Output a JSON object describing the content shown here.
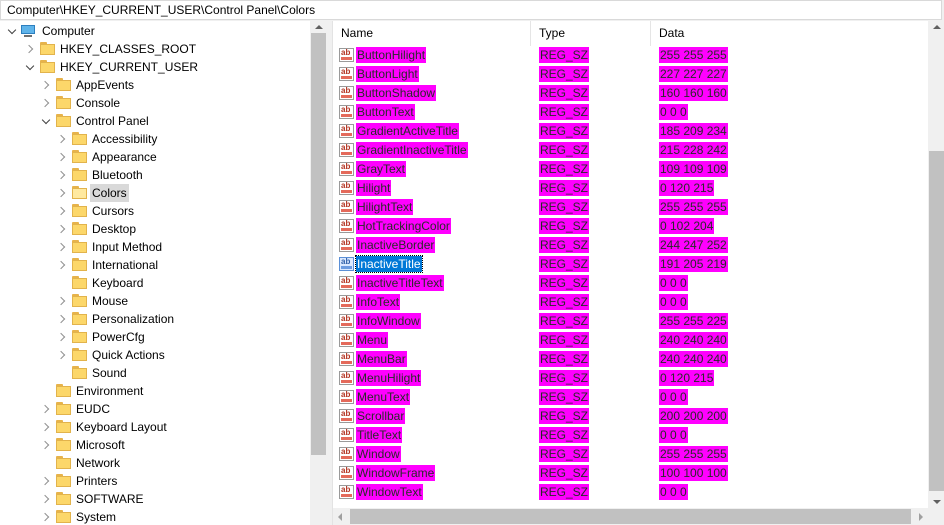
{
  "address_bar": {
    "path": "Computer\\HKEY_CURRENT_USER\\Control Panel\\Colors"
  },
  "colors": {
    "value_highlight": "#ff00ff",
    "selection": "#0078d7",
    "tree_selection": "#d9d9d9"
  },
  "tree": [
    {
      "label": "Computer",
      "depth": 0,
      "state": "expanded",
      "icon": "computer-icon"
    },
    {
      "label": "HKEY_CLASSES_ROOT",
      "depth": 1,
      "state": "collapsed",
      "icon": "folder-icon"
    },
    {
      "label": "HKEY_CURRENT_USER",
      "depth": 1,
      "state": "expanded",
      "icon": "folder-icon"
    },
    {
      "label": "AppEvents",
      "depth": 2,
      "state": "collapsed",
      "icon": "folder-icon"
    },
    {
      "label": "Console",
      "depth": 2,
      "state": "collapsed",
      "icon": "folder-icon"
    },
    {
      "label": "Control Panel",
      "depth": 2,
      "state": "expanded",
      "icon": "folder-icon"
    },
    {
      "label": "Accessibility",
      "depth": 3,
      "state": "collapsed",
      "icon": "folder-icon"
    },
    {
      "label": "Appearance",
      "depth": 3,
      "state": "collapsed",
      "icon": "folder-icon"
    },
    {
      "label": "Bluetooth",
      "depth": 3,
      "state": "collapsed",
      "icon": "folder-icon"
    },
    {
      "label": "Colors",
      "depth": 3,
      "state": "collapsed",
      "icon": "folder-icon",
      "selected": true
    },
    {
      "label": "Cursors",
      "depth": 3,
      "state": "collapsed",
      "icon": "folder-icon"
    },
    {
      "label": "Desktop",
      "depth": 3,
      "state": "collapsed",
      "icon": "folder-icon"
    },
    {
      "label": "Input Method",
      "depth": 3,
      "state": "collapsed",
      "icon": "folder-icon"
    },
    {
      "label": "International",
      "depth": 3,
      "state": "collapsed",
      "icon": "folder-icon"
    },
    {
      "label": "Keyboard",
      "depth": 3,
      "state": "none",
      "icon": "folder-icon"
    },
    {
      "label": "Mouse",
      "depth": 3,
      "state": "collapsed",
      "icon": "folder-icon"
    },
    {
      "label": "Personalization",
      "depth": 3,
      "state": "collapsed",
      "icon": "folder-icon"
    },
    {
      "label": "PowerCfg",
      "depth": 3,
      "state": "collapsed",
      "icon": "folder-icon"
    },
    {
      "label": "Quick Actions",
      "depth": 3,
      "state": "collapsed",
      "icon": "folder-icon"
    },
    {
      "label": "Sound",
      "depth": 3,
      "state": "none",
      "icon": "folder-icon"
    },
    {
      "label": "Environment",
      "depth": 2,
      "state": "none",
      "icon": "folder-icon"
    },
    {
      "label": "EUDC",
      "depth": 2,
      "state": "collapsed",
      "icon": "folder-icon"
    },
    {
      "label": "Keyboard Layout",
      "depth": 2,
      "state": "collapsed",
      "icon": "folder-icon"
    },
    {
      "label": "Microsoft",
      "depth": 2,
      "state": "collapsed",
      "icon": "folder-icon"
    },
    {
      "label": "Network",
      "depth": 2,
      "state": "none",
      "icon": "folder-icon"
    },
    {
      "label": "Printers",
      "depth": 2,
      "state": "collapsed",
      "icon": "folder-icon"
    },
    {
      "label": "SOFTWARE",
      "depth": 2,
      "state": "collapsed",
      "icon": "folder-icon"
    },
    {
      "label": "System",
      "depth": 2,
      "state": "collapsed",
      "icon": "folder-icon"
    }
  ],
  "list": {
    "columns": [
      "Name",
      "Type",
      "Data"
    ],
    "rows": [
      {
        "name": "ButtonHilight",
        "type": "REG_SZ",
        "data": "255 255 255"
      },
      {
        "name": "ButtonLight",
        "type": "REG_SZ",
        "data": "227 227 227"
      },
      {
        "name": "ButtonShadow",
        "type": "REG_SZ",
        "data": "160 160 160"
      },
      {
        "name": "ButtonText",
        "type": "REG_SZ",
        "data": "0 0 0"
      },
      {
        "name": "GradientActiveTitle",
        "type": "REG_SZ",
        "data": "185 209 234"
      },
      {
        "name": "GradientInactiveTitle",
        "type": "REG_SZ",
        "data": "215 228 242"
      },
      {
        "name": "GrayText",
        "type": "REG_SZ",
        "data": "109 109 109"
      },
      {
        "name": "Hilight",
        "type": "REG_SZ",
        "data": "0 120 215"
      },
      {
        "name": "HilightText",
        "type": "REG_SZ",
        "data": "255 255 255"
      },
      {
        "name": "HotTrackingColor",
        "type": "REG_SZ",
        "data": "0 102 204"
      },
      {
        "name": "InactiveBorder",
        "type": "REG_SZ",
        "data": "244 247 252"
      },
      {
        "name": "InactiveTitle",
        "type": "REG_SZ",
        "data": "191 205 219",
        "selected": true
      },
      {
        "name": "InactiveTitleText",
        "type": "REG_SZ",
        "data": "0 0 0"
      },
      {
        "name": "InfoText",
        "type": "REG_SZ",
        "data": "0 0 0"
      },
      {
        "name": "InfoWindow",
        "type": "REG_SZ",
        "data": "255 255 225"
      },
      {
        "name": "Menu",
        "type": "REG_SZ",
        "data": "240 240 240"
      },
      {
        "name": "MenuBar",
        "type": "REG_SZ",
        "data": "240 240 240"
      },
      {
        "name": "MenuHilight",
        "type": "REG_SZ",
        "data": "0 120 215"
      },
      {
        "name": "MenuText",
        "type": "REG_SZ",
        "data": "0 0 0"
      },
      {
        "name": "Scrollbar",
        "type": "REG_SZ",
        "data": "200 200 200"
      },
      {
        "name": "TitleText",
        "type": "REG_SZ",
        "data": "0 0 0"
      },
      {
        "name": "Window",
        "type": "REG_SZ",
        "data": "255 255 255"
      },
      {
        "name": "WindowFrame",
        "type": "REG_SZ",
        "data": "100 100 100"
      },
      {
        "name": "WindowText",
        "type": "REG_SZ",
        "data": "0 0 0"
      }
    ]
  }
}
